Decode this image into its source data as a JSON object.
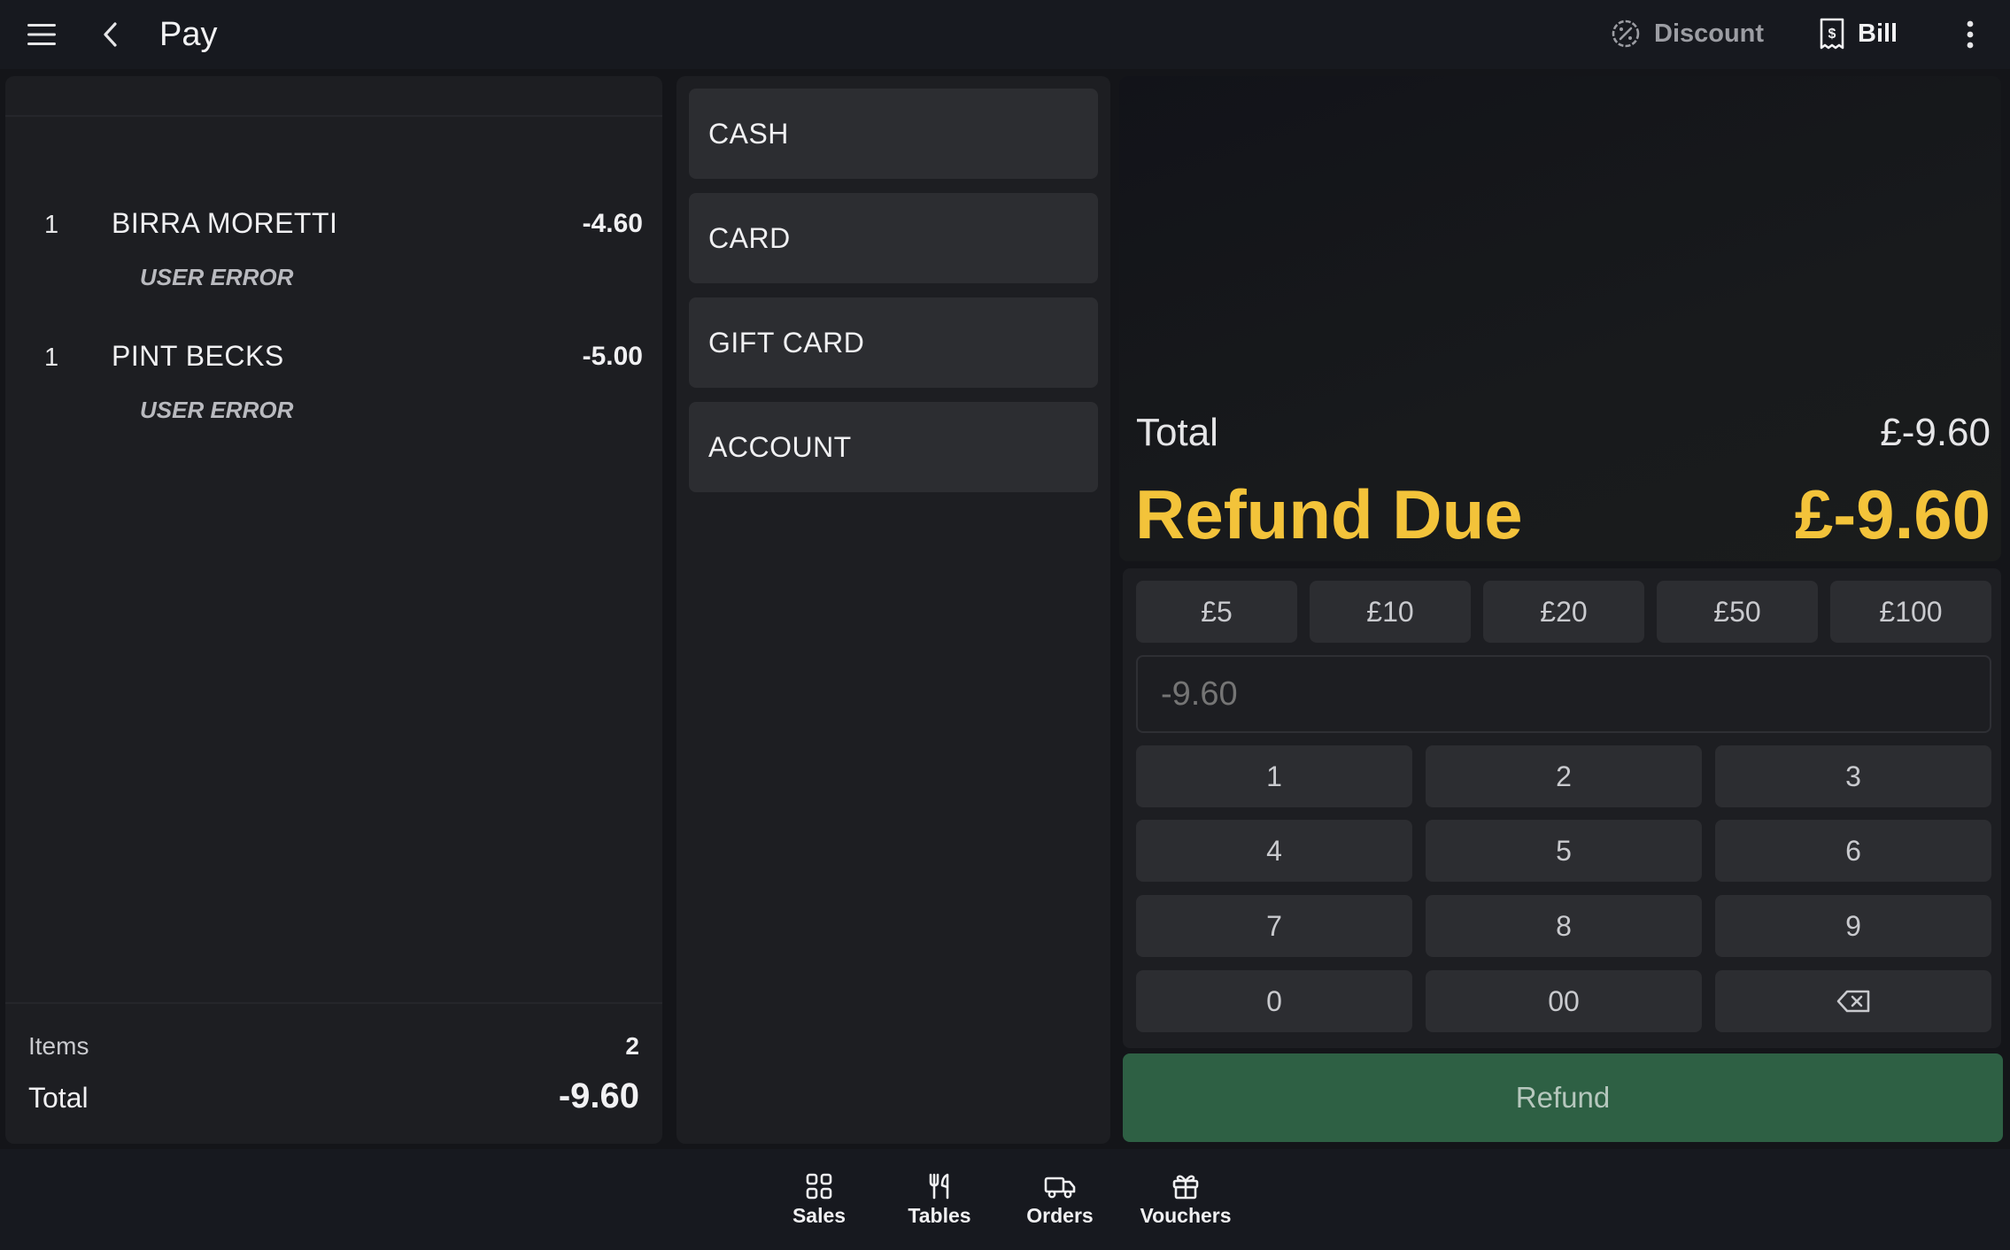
{
  "topbar": {
    "title": "Pay",
    "discount_label": "Discount",
    "bill_label": "Bill"
  },
  "order": {
    "lines": [
      {
        "qty": "1",
        "name": "BIRRA MORETTI",
        "price": "-4.60",
        "note": "USER ERROR"
      },
      {
        "qty": "1",
        "name": "PINT BECKS",
        "price": "-5.00",
        "note": "USER ERROR"
      }
    ],
    "items_label": "Items",
    "items_count": "2",
    "total_label": "Total",
    "total_value": "-9.60"
  },
  "tenders": [
    "CASH",
    "CARD",
    "GIFT CARD",
    "ACCOUNT"
  ],
  "summary": {
    "total_label": "Total",
    "total_value": "£-9.60",
    "refund_label": "Refund Due",
    "refund_value": "£-9.60"
  },
  "quick_amounts": [
    "£5",
    "£10",
    "£20",
    "£50",
    "£100"
  ],
  "amount_input": {
    "placeholder": "-9.60"
  },
  "keypad": [
    "1",
    "2",
    "3",
    "4",
    "5",
    "6",
    "7",
    "8",
    "9",
    "0",
    "00"
  ],
  "refund_button": "Refund",
  "bottom_nav": [
    {
      "label": "Sales",
      "icon": "grid-icon"
    },
    {
      "label": "Tables",
      "icon": "cutlery-icon"
    },
    {
      "label": "Orders",
      "icon": "delivery-truck-icon"
    },
    {
      "label": "Vouchers",
      "icon": "gift-icon"
    }
  ],
  "colors": {
    "accent_yellow": "#f3c33a",
    "refund_green": "#2e6044",
    "background": "#141519",
    "panel": "#1d1e22",
    "button": "#2c2d31"
  }
}
